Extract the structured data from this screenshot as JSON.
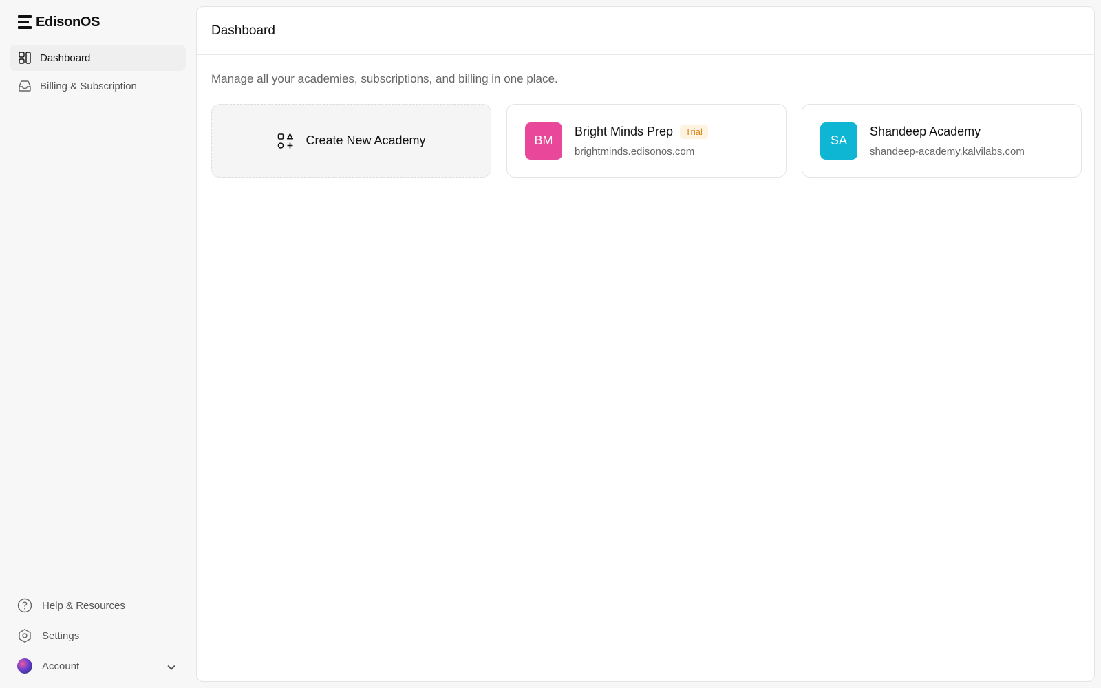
{
  "app": {
    "name": "EdisonOS"
  },
  "sidebar": {
    "items": [
      {
        "label": "Dashboard",
        "icon": "dashboard-icon",
        "active": true
      },
      {
        "label": "Billing & Subscription",
        "icon": "inbox-icon",
        "active": false
      }
    ],
    "bottom": {
      "help": "Help & Resources",
      "settings": "Settings",
      "account": "Account"
    }
  },
  "main": {
    "title": "Dashboard",
    "subtitle": "Manage all your academies, subscriptions, and billing in one place.",
    "create_label": "Create New Academy",
    "academies": [
      {
        "initials": "BM",
        "name": "Bright Minds Prep",
        "domain": "brightminds.edisonos.com",
        "tag": "Trial",
        "color": "#e9489a"
      },
      {
        "initials": "SA",
        "name": "Shandeep Academy",
        "domain": "shandeep-academy.kalvilabs.com",
        "tag": "",
        "color": "#0fb6d4"
      }
    ]
  },
  "colors": {
    "trial_text": "#d9871c",
    "trial_bg": "#fdf3e0"
  }
}
